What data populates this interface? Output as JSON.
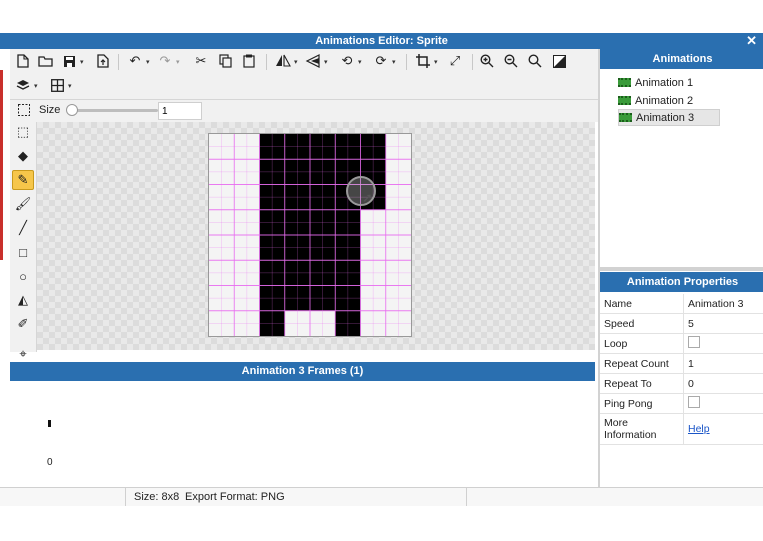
{
  "window": {
    "title": "Animations Editor: Sprite",
    "close_label": "✕"
  },
  "toolbar": {
    "icons": [
      "new-file-icon",
      "open-folder-icon",
      "save-icon",
      "export-icon",
      "undo-icon",
      "redo-icon",
      "cut-icon",
      "copy-icon",
      "paste-icon",
      "flip-horizontal-icon",
      "flip-vertical-icon",
      "rotate-left-icon",
      "rotate-right-icon",
      "crop-icon",
      "resize-icon",
      "zoom-in-icon",
      "zoom-out-icon",
      "zoom-fit-icon",
      "background-color-icon",
      "layers-icon",
      "grid-icon"
    ]
  },
  "brush": {
    "size_label": "Size",
    "size_value": "1",
    "size_fraction": 0.0
  },
  "tools": [
    {
      "name": "selection-icon",
      "glyph": "⬚"
    },
    {
      "name": "eraser-icon",
      "glyph": "◆"
    },
    {
      "name": "pencil-icon",
      "glyph": "✎",
      "active": true
    },
    {
      "name": "brush-icon",
      "glyph": "🖌"
    },
    {
      "name": "line-icon",
      "glyph": "╱"
    },
    {
      "name": "rectangle-icon",
      "glyph": "□"
    },
    {
      "name": "ellipse-icon",
      "glyph": "○"
    },
    {
      "name": "fill-bucket-icon",
      "glyph": "◭"
    },
    {
      "name": "eyedropper-icon",
      "glyph": "✐"
    },
    {
      "name": "hotspot-icon",
      "glyph": "⌖"
    }
  ],
  "sprite": {
    "columns": 8,
    "rows": 8,
    "pixels": [
      [
        0,
        0,
        1,
        1,
        1,
        1,
        1,
        0
      ],
      [
        0,
        0,
        1,
        1,
        1,
        1,
        1,
        0
      ],
      [
        0,
        0,
        1,
        1,
        1,
        1,
        1,
        0
      ],
      [
        0,
        0,
        1,
        1,
        1,
        1,
        0,
        0
      ],
      [
        0,
        0,
        1,
        1,
        1,
        1,
        0,
        0
      ],
      [
        0,
        0,
        1,
        1,
        1,
        1,
        0,
        0
      ],
      [
        0,
        0,
        1,
        1,
        1,
        1,
        0,
        0
      ],
      [
        0,
        0,
        1,
        0,
        0,
        1,
        0,
        0
      ]
    ],
    "colors": {
      "filled": "#000000",
      "grid": "#e86cf0"
    }
  },
  "frames_panel": {
    "title": "Animation 3 Frames (1)",
    "frame_numbers": [
      "0"
    ]
  },
  "statusbar": {
    "size_text": "Size: 8x8",
    "format_text": "Export Format: PNG"
  },
  "animations_panel": {
    "title": "Animations",
    "items": [
      {
        "label": "Animation 1",
        "selected": false
      },
      {
        "label": "Animation 2",
        "selected": false
      },
      {
        "label": "Animation 3",
        "selected": true
      }
    ]
  },
  "properties_panel": {
    "title": "Animation Properties",
    "rows": [
      {
        "key": "Name",
        "value": "Animation 3",
        "type": "text"
      },
      {
        "key": "Speed",
        "value": "5",
        "type": "text"
      },
      {
        "key": "Loop",
        "value": "",
        "type": "checkbox"
      },
      {
        "key": "Repeat Count",
        "value": "1",
        "type": "text"
      },
      {
        "key": "Repeat To",
        "value": "0",
        "type": "text"
      },
      {
        "key": "Ping Pong",
        "value": "",
        "type": "checkbox"
      },
      {
        "key": "More Information",
        "value": "Help",
        "type": "link"
      }
    ]
  },
  "colors": {
    "accent": "#2a6fb0",
    "active_tool": "#f6c64a"
  }
}
